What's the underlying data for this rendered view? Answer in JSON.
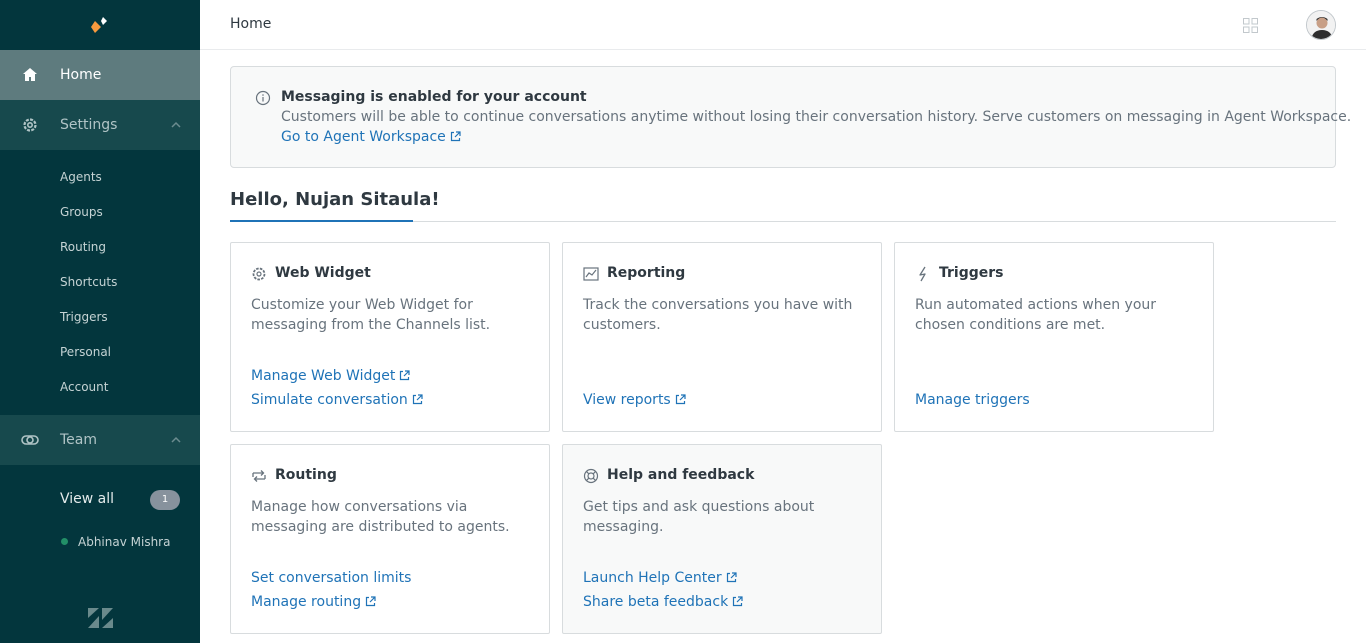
{
  "sidebar": {
    "home": "Home",
    "settings": {
      "label": "Settings",
      "items": [
        "Agents",
        "Groups",
        "Routing",
        "Shortcuts",
        "Triggers",
        "Personal",
        "Account"
      ]
    },
    "team": {
      "label": "Team",
      "view_all": "View all",
      "count": "1",
      "member": "Abhinav Mishra"
    }
  },
  "header": {
    "title": "Home"
  },
  "notice": {
    "title": "Messaging is enabled for your account",
    "body": "Customers will be able to continue conversations anytime without losing their conversation history. Serve customers on messaging in Agent Workspace.",
    "link": "Go to Agent Workspace"
  },
  "greeting": "Hello, Nujan Sitaula!",
  "cards": [
    {
      "title": "Web Widget",
      "icon": "gear-icon",
      "description": "Customize your Web Widget for messaging from the Channels list.",
      "links": [
        "Manage Web Widget",
        "Simulate conversation"
      ]
    },
    {
      "title": "Reporting",
      "icon": "chart-icon",
      "description": "Track the conversations you have with customers.",
      "links": [
        "View reports"
      ]
    },
    {
      "title": "Triggers",
      "icon": "lightning-icon",
      "description": "Run automated actions when your chosen conditions are met.",
      "links": [
        "Manage triggers"
      ]
    },
    {
      "title": "Routing",
      "icon": "routing-icon",
      "description": "Manage how conversations via messaging are distributed to agents.",
      "links": [
        "Set conversation limits",
        "Manage routing"
      ]
    },
    {
      "title": "Help and feedback",
      "icon": "lifebuoy-icon",
      "description": "Get tips and ask questions about messaging.",
      "links": [
        "Launch Help Center",
        "Share beta feedback"
      ]
    }
  ],
  "colors": {
    "sidebar_bg": "#03363d",
    "active_bg": "#5e7b7e",
    "section_bg": "#17494d",
    "link": "#1f73b7",
    "brand_orange": "#f79a3e"
  }
}
